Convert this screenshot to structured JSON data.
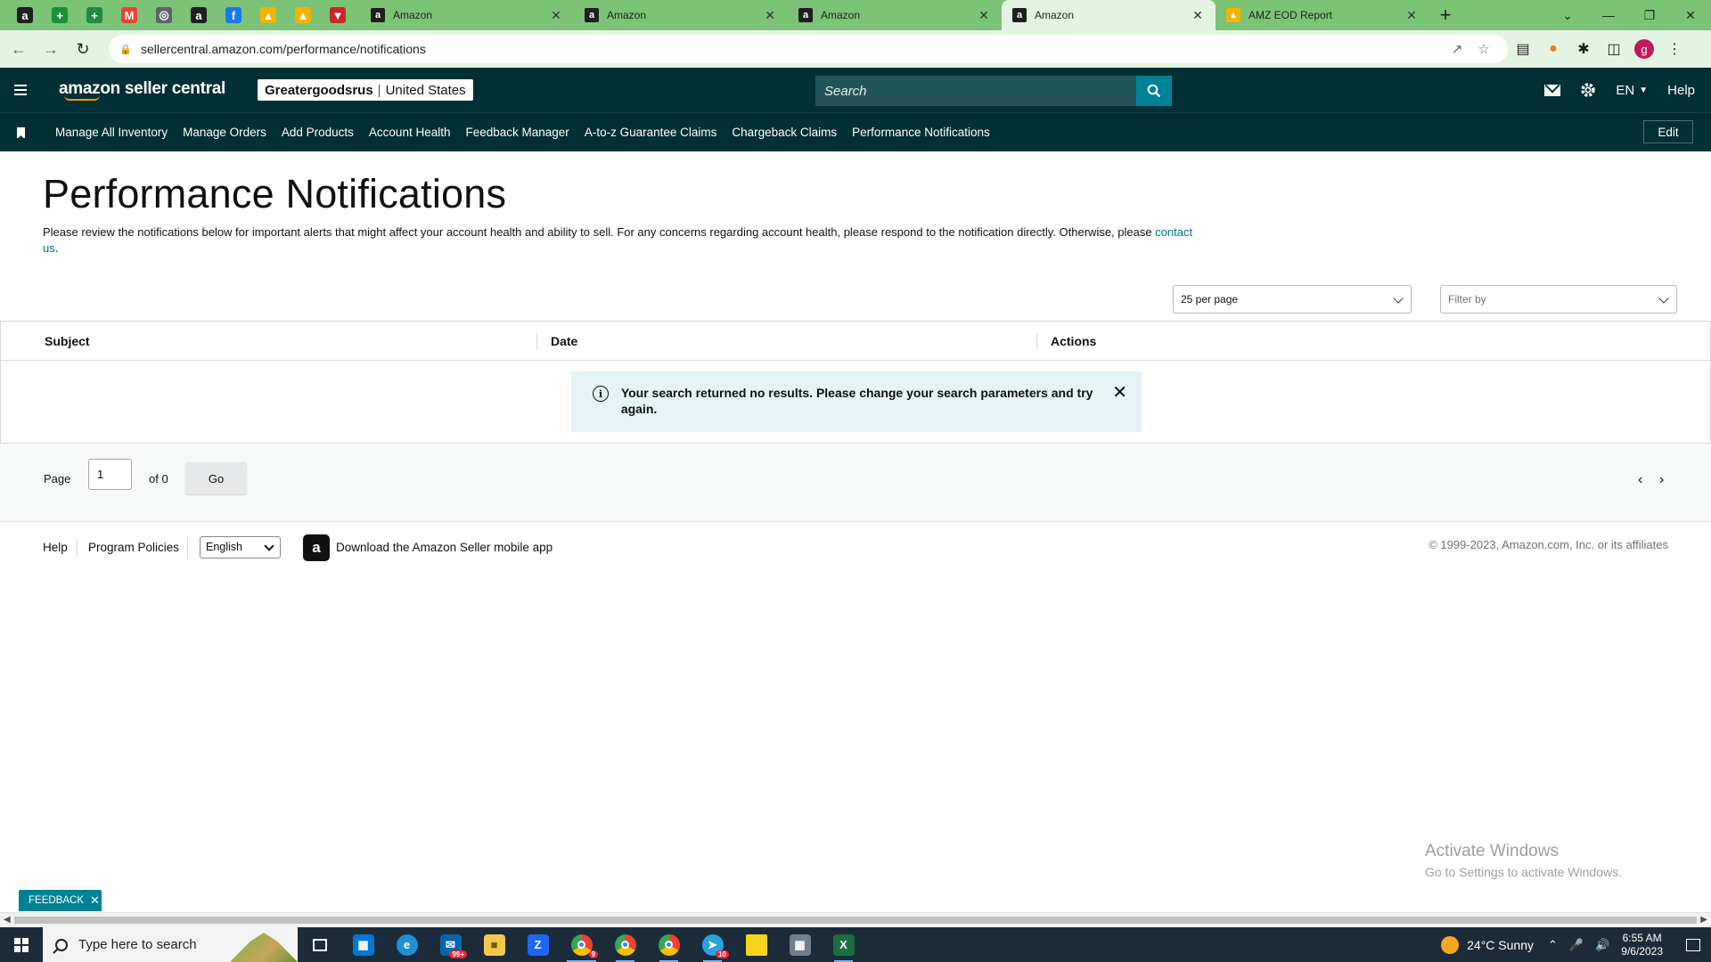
{
  "browser": {
    "pinned_tabs": [
      {
        "icon": "amazon-favicon",
        "glyph": "a",
        "color": "#1f1f1f"
      },
      {
        "icon": "green-plus-favicon",
        "glyph": "+",
        "color": "#1e8e3e"
      },
      {
        "icon": "green-plus-favicon",
        "glyph": "+",
        "color": "#1e8e3e"
      },
      {
        "icon": "gmail-favicon",
        "glyph": "M",
        "color": "#ea4335"
      },
      {
        "icon": "circle-favicon",
        "glyph": "◎",
        "color": "#5f6368"
      },
      {
        "icon": "amazon-favicon",
        "glyph": "a",
        "color": "#1f1f1f"
      },
      {
        "icon": "facebook-favicon",
        "glyph": "f",
        "color": "#1877f2"
      },
      {
        "icon": "google-drive-favicon",
        "glyph": "▲",
        "color": "#f4b400"
      },
      {
        "icon": "google-drive-favicon",
        "glyph": "▲",
        "color": "#f4b400"
      },
      {
        "icon": "vpn-favicon",
        "glyph": "▼",
        "color": "#c62828"
      }
    ],
    "tabs": [
      {
        "title": "Amazon",
        "active": false
      },
      {
        "title": "Amazon",
        "active": false
      },
      {
        "title": "Amazon",
        "active": false
      },
      {
        "title": "Amazon",
        "active": true
      },
      {
        "title": "AMZ EOD Report",
        "active": false
      }
    ],
    "url": "sellercentral.amazon.com/performance/notifications",
    "profile_initial": "g"
  },
  "header": {
    "logo_text": "amazon seller central",
    "store_name": "Greatergoodsrus",
    "marketplace": "United States",
    "search_placeholder": "Search",
    "language": "EN",
    "help": "Help"
  },
  "nav": {
    "links": [
      "Manage All Inventory",
      "Manage Orders",
      "Add Products",
      "Account Health",
      "Feedback Manager",
      "A-to-z Guarantee Claims",
      "Chargeback Claims",
      "Performance Notifications"
    ],
    "edit_label": "Edit"
  },
  "main": {
    "title": "Performance Notifications",
    "intro": "Please review the notifications below for important alerts that might affect your account health and ability to sell. For any concerns regarding account health, please respond to the notification directly. Otherwise, please ",
    "contact_link": "contact us",
    "intro_end": ".",
    "per_page": "25 per page",
    "filter_placeholder": "Filter by",
    "columns": [
      "Subject",
      "Date",
      "Actions"
    ],
    "alert_message": "Your search returned no results. Please change your search parameters and try again."
  },
  "pager": {
    "page_label": "Page",
    "page_value": "1",
    "of_label": "of 0",
    "go_label": "Go"
  },
  "footer": {
    "help": "Help",
    "program_policies": "Program Policies",
    "language": "English",
    "app_link": "Download the Amazon Seller mobile app",
    "copyright": "© 1999-2023, Amazon.com, Inc. or its affiliates"
  },
  "watermark": {
    "line1": "Activate Windows",
    "line2": "Go to Settings to activate Windows."
  },
  "feedback_label": "FEEDBACK",
  "taskbar": {
    "search_placeholder": "Type here to search",
    "weather": "24°C  Sunny",
    "time": "6:55 AM",
    "date": "9/6/2023",
    "mail_badge": "99+",
    "chrome_badge": "9",
    "telegram_badge": "10"
  }
}
